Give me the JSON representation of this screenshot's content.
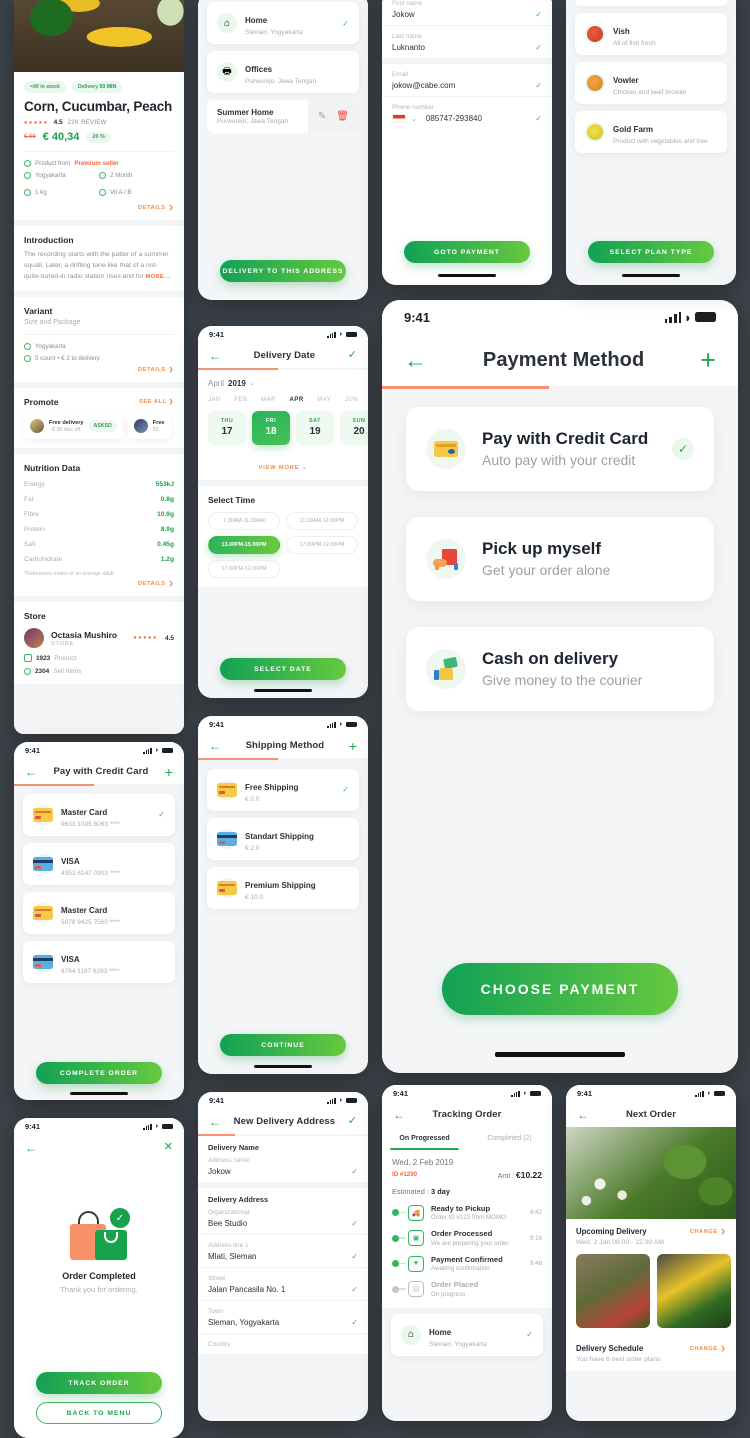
{
  "status": {
    "time": "9:41"
  },
  "product": {
    "badges": [
      {
        "text": "<40 in stock"
      },
      {
        "prefix": "Delivery ",
        "strong": "50 MIN"
      }
    ],
    "title": "Corn, Cucumbar, Peach",
    "rating": "4.5",
    "reviews": "22K REVIEW",
    "old_price": "€ 66",
    "price": "€ 40,34",
    "discount": "20 %",
    "seller_prefix": "Product from",
    "seller": "Premium seller",
    "features": [
      "Yogyakarta",
      "2 Month",
      "1 kg",
      "Vit A / B"
    ],
    "details_label": "DETAILS",
    "introduction": {
      "heading": "Introduction",
      "body": "The recording starts with the patter of a summer squall. Later, a drifting tone like that of a not-quite-tuned-in radio station rises and for ",
      "more": "MORE..."
    },
    "variant": {
      "heading": "Variant",
      "sub": "Size and Package",
      "location": "Yogyakarta",
      "courier": "5 courir  •  € 2 to delivery"
    },
    "promote": {
      "heading": "Promote",
      "see_all": "SEE ALL",
      "items": [
        {
          "title": "Free delivery",
          "sub": "- € 30 disc off",
          "code": "ASKSD"
        },
        {
          "title": "Free",
          "sub": "53",
          "code": ""
        }
      ]
    },
    "nutrition": {
      "heading": "Nutrition Data",
      "rows": [
        {
          "key": "Energy",
          "value": "553kJ"
        },
        {
          "key": "Fat",
          "value": "0.8g"
        },
        {
          "key": "Fibre",
          "value": "10.9g"
        },
        {
          "key": "Protein",
          "value": "8.9g"
        },
        {
          "key": "Salt",
          "value": "0.45g"
        },
        {
          "key": "Carbohidrate",
          "value": "1.2g"
        }
      ],
      "note": "*References intake of an average adult"
    },
    "store": {
      "heading": "Store",
      "name": "Octasia Mushiro",
      "label": "STORE",
      "rating": "4.5",
      "products_count": "1923",
      "products_label": "Product",
      "sell_count": "2304",
      "sell_label": "Sell Items"
    }
  },
  "credit_cards": {
    "title": "Pay with Credit Card",
    "items": [
      {
        "name": "Master Card",
        "number": "9633 1095 8063 ****",
        "brand": "mc",
        "selected": true
      },
      {
        "name": "VISA",
        "number": "4953 6147 0903 ****",
        "brand": "visa",
        "selected": false
      },
      {
        "name": "Master Card",
        "number": "5078 9425 7560 ****",
        "brand": "mc",
        "selected": false
      },
      {
        "name": "VISA",
        "number": "8784 1187 6263 ****",
        "brand": "visa",
        "selected": false
      }
    ],
    "cta": "COMPLETE ORDER"
  },
  "order_completed": {
    "title": "Order Completed",
    "subtitle": "Thank you for ordering.",
    "primary_cta": "TRACK ORDER",
    "secondary_cta": "BACK TO MENU"
  },
  "address_list": {
    "items": [
      {
        "name": "Home",
        "sub": "Sleman, Yogyakarta",
        "icon": "home-icon",
        "selected": true
      },
      {
        "name": "Offices",
        "sub": "Purworejo, Jawa Tengah",
        "icon": "office-icon",
        "selected": false
      },
      {
        "name": "Summer Home",
        "sub": "Purworejo, Jawa Tengah",
        "icon": "home-icon",
        "selected": false,
        "swiped": true
      }
    ],
    "cta": "DELIVERY TO THIS ADDRESS"
  },
  "delivery_date": {
    "title": "Delivery Date",
    "month_label": "April",
    "year": "2019",
    "months": [
      "JAN",
      "FEB",
      "MAR",
      "APR",
      "MAY",
      "JUN"
    ],
    "active_month": "APR",
    "days": [
      {
        "dow": "THU",
        "num": "17",
        "selected": false
      },
      {
        "dow": "FRI",
        "num": "18",
        "selected": true
      },
      {
        "dow": "SAT",
        "num": "19",
        "selected": false
      },
      {
        "dow": "SUN",
        "num": "20",
        "selected": false
      }
    ],
    "view_more": "VIEW MORE",
    "time_heading": "Select Time",
    "slots": [
      {
        "label": "7.30AM-11.00AM",
        "selected": false
      },
      {
        "label": "11.00AM-12.00PM",
        "selected": false
      },
      {
        "label": "13.00PM-15.00PM",
        "selected": true
      },
      {
        "label": "17.00PM-12.00PM",
        "selected": false
      },
      {
        "label": "17.00PM-12.00PM",
        "selected": false
      }
    ],
    "cta": "SELECT DATE"
  },
  "shipping_method": {
    "title": "Shipping Method",
    "items": [
      {
        "name": "Free Shipping",
        "price": "€ 0.0",
        "brand": "mc",
        "selected": true
      },
      {
        "name": "Standart Shipping",
        "price": "€ 2.0",
        "brand": "visa",
        "selected": false
      },
      {
        "name": "Premium Shipping",
        "price": "€ 10.0",
        "brand": "mc",
        "selected": false
      }
    ],
    "cta": "CONTINUE"
  },
  "new_address": {
    "title": "New Delivery Address",
    "section_name": "Delivery Name",
    "section_address": "Delivery Address",
    "fields": [
      {
        "label": "Address name",
        "value": "Jokow"
      },
      {
        "label": "Organizational",
        "value": "Bee Studio"
      },
      {
        "label": "Address line 1",
        "value": "Mlati, Sleman"
      },
      {
        "label": "Street",
        "value": "Jalan Pancasila No. 1"
      },
      {
        "label": "Town",
        "value": "Sleman, Yogyakarta"
      },
      {
        "label": "Country",
        "value": ""
      }
    ]
  },
  "personal_info": {
    "fields": [
      {
        "label": "First name",
        "value": "Jokow"
      },
      {
        "label": "Last name",
        "value": "Luknanto"
      },
      {
        "label": "Email",
        "value": "jokow@cabe.com"
      }
    ],
    "phone_label": "Phone number",
    "phone_value": "085747-293840",
    "cta": "GOTO PAYMENT"
  },
  "payment_method": {
    "title": "Payment Method",
    "options": [
      {
        "title": "Pay with Credit Card",
        "subtitle": "Auto pay with your credit",
        "icon": "credit-card-icon",
        "selected": true
      },
      {
        "title": "Pick up myself",
        "subtitle": "Get your order alone",
        "icon": "pickup-bag-icon",
        "selected": false
      },
      {
        "title": "Cash on delivery",
        "subtitle": "Give money to the courier",
        "icon": "cash-hand-icon",
        "selected": false
      }
    ],
    "cta": "CHOOSE PAYMENT"
  },
  "plan_list": {
    "items": [
      {
        "name": "Vish",
        "sub": "All of fish fresh",
        "icon": "fish-icon"
      },
      {
        "name": "Vowler",
        "sub": "Chicken and beef browler",
        "icon": "chicken-icon"
      },
      {
        "name": "Gold Farm",
        "sub": "Product with vegetables and tree",
        "icon": "farm-icon"
      }
    ],
    "cta": "SELECT PLAN TYPE"
  },
  "tracking": {
    "title": "Tracking Order",
    "tabs": [
      {
        "label": "On Progressed",
        "active": true
      },
      {
        "label": "Completed (2)",
        "active": false
      }
    ],
    "date": "Wed, 2 Feb 2019",
    "order_id": "ID #1290",
    "amount_label": "Amt : ",
    "amount": "€10.22",
    "estimated_label": "Estimated : ",
    "estimated": "3 day",
    "steps": [
      {
        "title": "Ready to Pickup",
        "sub": "Order ID #123 from MOMO",
        "time": "8:42",
        "done": true,
        "icon": "truck-icon"
      },
      {
        "title": "Order Processed",
        "sub": "We are preparing your order",
        "time": "9:16",
        "done": true,
        "icon": "bag-icon"
      },
      {
        "title": "Payment Confirmed",
        "sub": "Awaiting confirmation",
        "time": "9:46",
        "done": true,
        "icon": "shield-icon"
      },
      {
        "title": "Order Placed",
        "sub": "On progress",
        "time": "",
        "done": false,
        "icon": "box-icon"
      }
    ],
    "address": {
      "name": "Home",
      "sub": "Sleman, Yogyakarta"
    }
  },
  "next_order": {
    "title": "Next Order",
    "upcoming": {
      "title": "Upcoming Delivery",
      "sub": "Wed, 2 Jan 08.00 - 12.00 AM",
      "change": "CHANGE"
    },
    "schedule": {
      "title": "Delivery Schedule",
      "sub": "You have 6 next order plans",
      "change": "CHANGE"
    }
  }
}
